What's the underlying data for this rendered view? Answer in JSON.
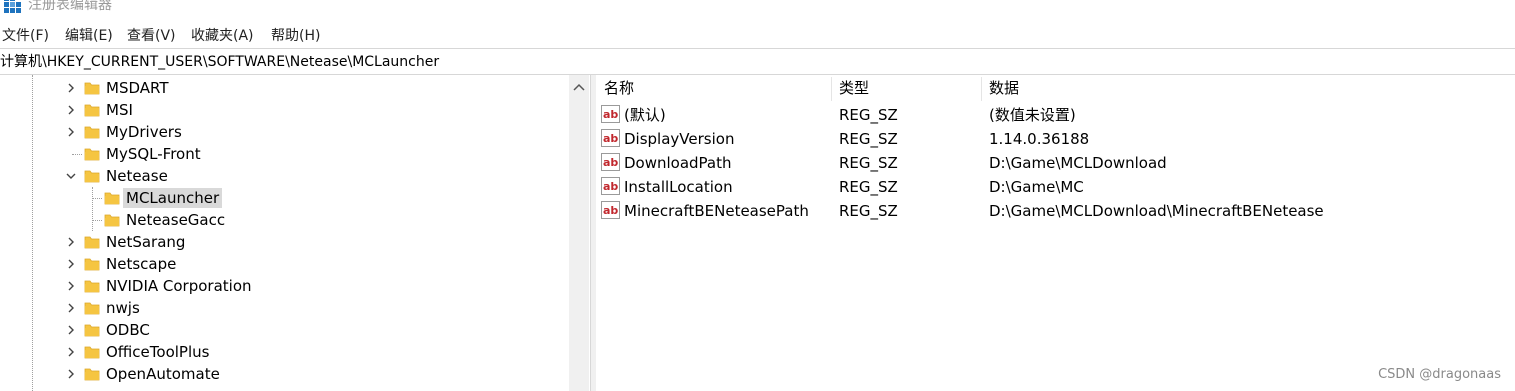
{
  "window": {
    "title": "注册表编辑器"
  },
  "menu": [
    "文件(F)",
    "编辑(E)",
    "查看(V)",
    "收藏夹(A)",
    "帮助(H)"
  ],
  "address": "计算机\\HKEY_CURRENT_USER\\SOFTWARE\\Netease\\MCLauncher",
  "tree": [
    {
      "label": "MSDART",
      "state": "collapsed"
    },
    {
      "label": "MSI",
      "state": "collapsed"
    },
    {
      "label": "MyDrivers",
      "state": "collapsed"
    },
    {
      "label": "MySQL-Front",
      "state": "leaf"
    },
    {
      "label": "Netease",
      "state": "expanded"
    },
    {
      "label": "MCLauncher",
      "state": "child-selected"
    },
    {
      "label": "NeteaseGacc",
      "state": "child"
    },
    {
      "label": "NetSarang",
      "state": "collapsed"
    },
    {
      "label": "Netscape",
      "state": "collapsed"
    },
    {
      "label": "NVIDIA Corporation",
      "state": "collapsed"
    },
    {
      "label": "nwjs",
      "state": "collapsed"
    },
    {
      "label": "ODBC",
      "state": "collapsed"
    },
    {
      "label": "OfficeToolPlus",
      "state": "collapsed"
    },
    {
      "label": "OpenAutomate",
      "state": "collapsed"
    }
  ],
  "columns": {
    "name": "名称",
    "type": "类型",
    "data": "数据"
  },
  "values": [
    {
      "name": "(默认)",
      "type": "REG_SZ",
      "data": "(数值未设置)"
    },
    {
      "name": "DisplayVersion",
      "type": "REG_SZ",
      "data": "1.14.0.36188"
    },
    {
      "name": "DownloadPath",
      "type": "REG_SZ",
      "data": "D:\\Game\\MCLDownload"
    },
    {
      "name": "InstallLocation",
      "type": "REG_SZ",
      "data": "D:\\Game\\MC"
    },
    {
      "name": "MinecraftBENeteasePath",
      "type": "REG_SZ",
      "data": "D:\\Game\\MCLDownload\\MinecraftBENetease"
    }
  ],
  "watermark": "CSDN @dragonaas",
  "colors": {
    "folder": "#f5c542",
    "folder_dark": "#dca72a",
    "ab_red": "#c1272d",
    "selection": "#d9d9d9",
    "icon_blue": "#1e73be"
  }
}
